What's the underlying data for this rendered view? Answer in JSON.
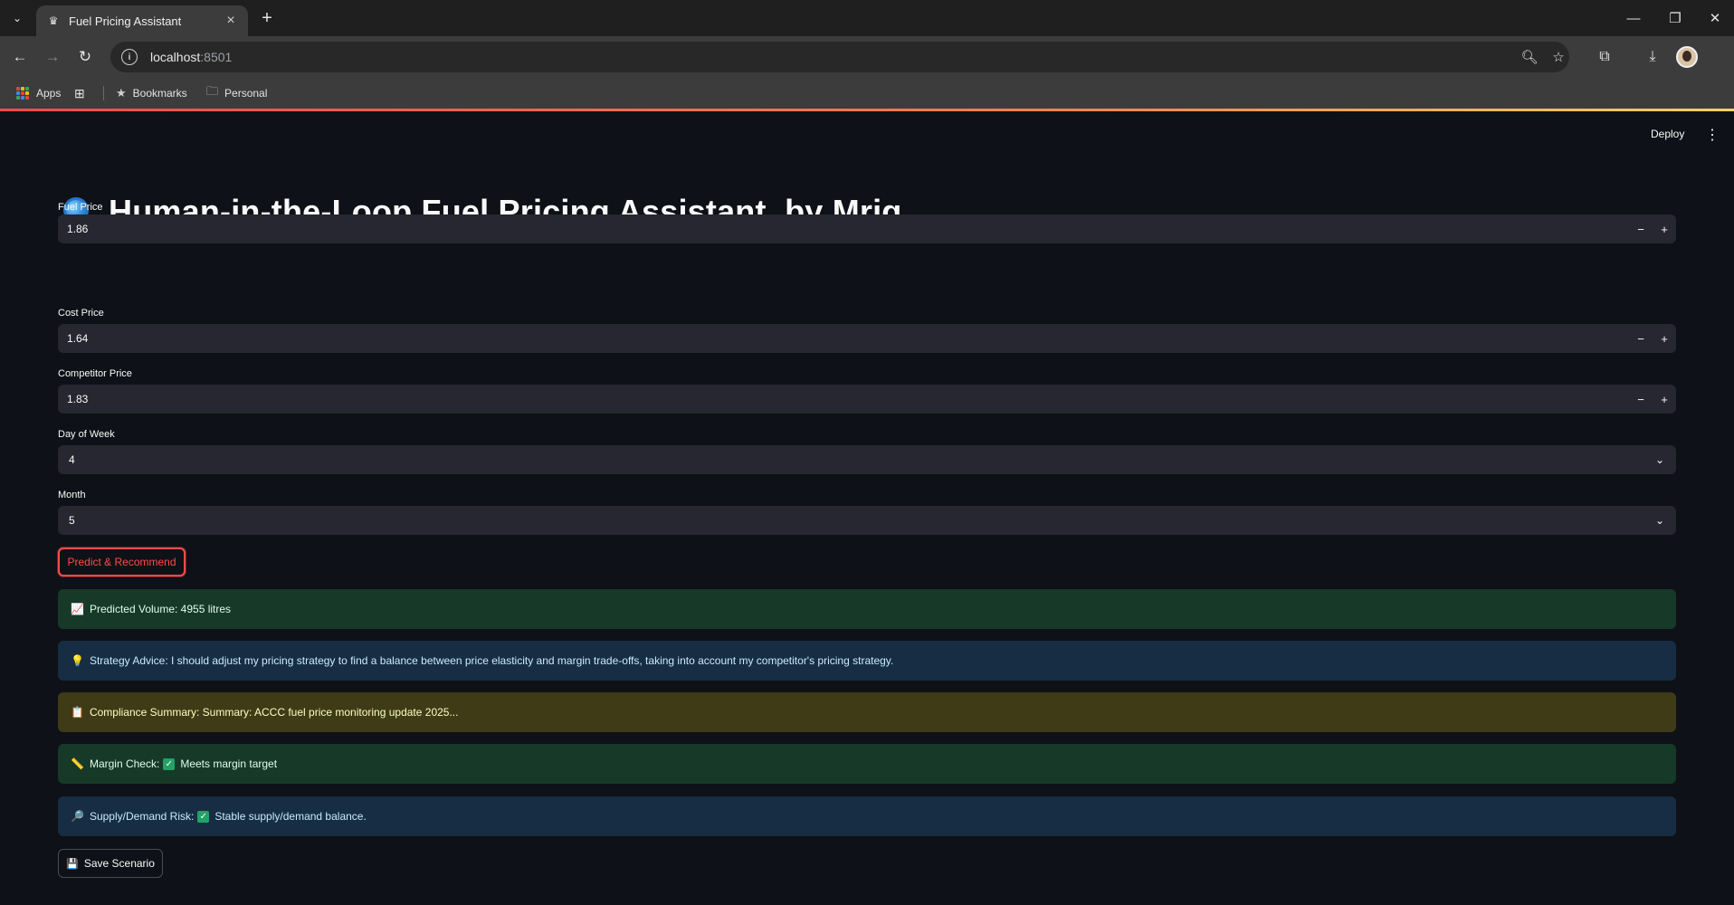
{
  "browser": {
    "tab_title": "Fuel Pricing Assistant",
    "url_host": "localhost",
    "url_port": ":8501",
    "bookmarks": [
      "Apps",
      "Bookmarks",
      "Personal"
    ]
  },
  "app": {
    "deploy_label": "Deploy",
    "title": "Human-in-the-Loop Fuel Pricing Assistant, by Mrig",
    "fields": {
      "fuel_price": {
        "label": "Fuel Price",
        "value": "1.86"
      },
      "cost_price": {
        "label": "Cost Price",
        "value": "1.64"
      },
      "competitor_price": {
        "label": "Competitor Price",
        "value": "1.83"
      },
      "day_of_week": {
        "label": "Day of Week",
        "value": "4"
      },
      "month": {
        "label": "Month",
        "value": "5"
      }
    },
    "step_minus": "−",
    "step_plus": "+",
    "predict_button": "Predict & Recommend",
    "results": {
      "predicted_volume": "Predicted Volume: 4955 litres",
      "strategy_advice": "Strategy Advice: I should adjust my pricing strategy to find a balance between price elasticity and margin trade-offs, taking into account my competitor's pricing strategy.",
      "compliance_summary": "Compliance Summary: Summary: ACCC fuel price monitoring update 2025...",
      "margin_check_label": "Margin Check:",
      "margin_check_value": "Meets margin target",
      "supply_demand_label": "Supply/Demand Risk:",
      "supply_demand_value": "Stable supply/demand balance."
    },
    "save_button": "Save Scenario"
  },
  "colors": {
    "accent": "#ff4b4b",
    "background": "#0e1117",
    "input_bg": "#262730",
    "success_bg": "#173928",
    "info_bg": "#172d43",
    "warning_bg": "#3e3b16"
  }
}
